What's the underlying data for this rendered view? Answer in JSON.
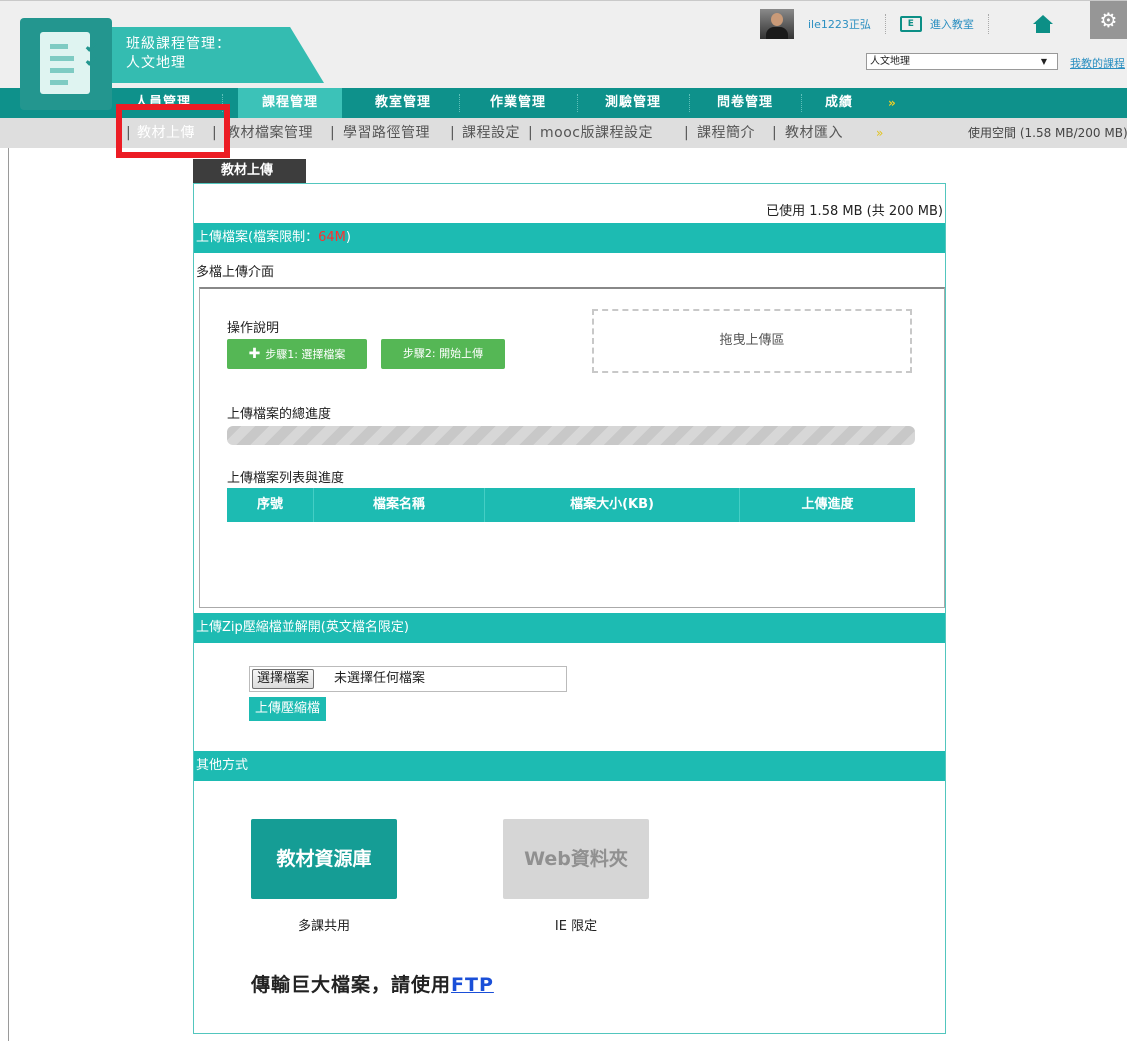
{
  "header": {
    "course_label": "班級課程管理：",
    "course_name": "人文地理",
    "user_name": "ile1223正弘",
    "classroom_link": "進入教室",
    "classroom_icon_text": "E",
    "course_select_value": "人文地理",
    "my_courses_link": "我教的課程",
    "icons": [
      "app-logo",
      "user-avatar",
      "classroom-icon",
      "home-icon",
      "gear-icon"
    ]
  },
  "main_nav": {
    "items": [
      "人員管理",
      "課程管理",
      "教室管理",
      "作業管理",
      "測驗管理",
      "問卷管理",
      "成績"
    ],
    "active_index": 1,
    "more_icon": "»"
  },
  "sub_nav": {
    "items": [
      "教材上傳",
      "教材檔案管理",
      "學習路徑管理",
      "課程設定",
      "mooc版課程設定",
      "課程簡介",
      "教材匯入"
    ],
    "active_index": 0,
    "more_icon": "»",
    "space_usage": "使用空間 (1.58 MB/200 MB)"
  },
  "page": {
    "tab_label": "教材上傳",
    "used_text": "已使用 1.58 MB (共 200 MB)",
    "upload_section": {
      "title_prefix": "上傳檔案(檔案限制：",
      "limit": "64M",
      "title_suffix": ")",
      "multi_title": "多檔上傳介面",
      "instruction_label": "操作說明",
      "step1_label": "步驟1: 選擇檔案",
      "step2_label": "步驟2: 開始上傳",
      "drop_zone_label": "拖曳上傳區",
      "progress_label": "上傳檔案的總進度",
      "progress_percent": 0,
      "list_label": "上傳檔案列表與進度",
      "table_headers": [
        "序號",
        "檔案名稱",
        "檔案大小(KB)",
        "上傳進度"
      ]
    },
    "zip_section": {
      "title": "上傳Zip壓縮檔並解開(英文檔名限定)",
      "choose_button": "選擇檔案",
      "file_status": "未選擇任何檔案",
      "upload_button": "上傳壓縮檔"
    },
    "other_section": {
      "title": "其他方式",
      "tiles": [
        {
          "label": "教材資源庫",
          "caption": "多課共用"
        },
        {
          "label": "Web資料夾",
          "caption": "IE 限定"
        }
      ],
      "ftp_text": "傳輸巨大檔案，請使用",
      "ftp_link": "FTP"
    }
  },
  "colors": {
    "teal_dark": "#0e918b",
    "teal_band": "#1dbbb2",
    "active_tab": "#3cc2b8",
    "green_button": "#55b755",
    "highlight_red": "#ec1c24"
  }
}
